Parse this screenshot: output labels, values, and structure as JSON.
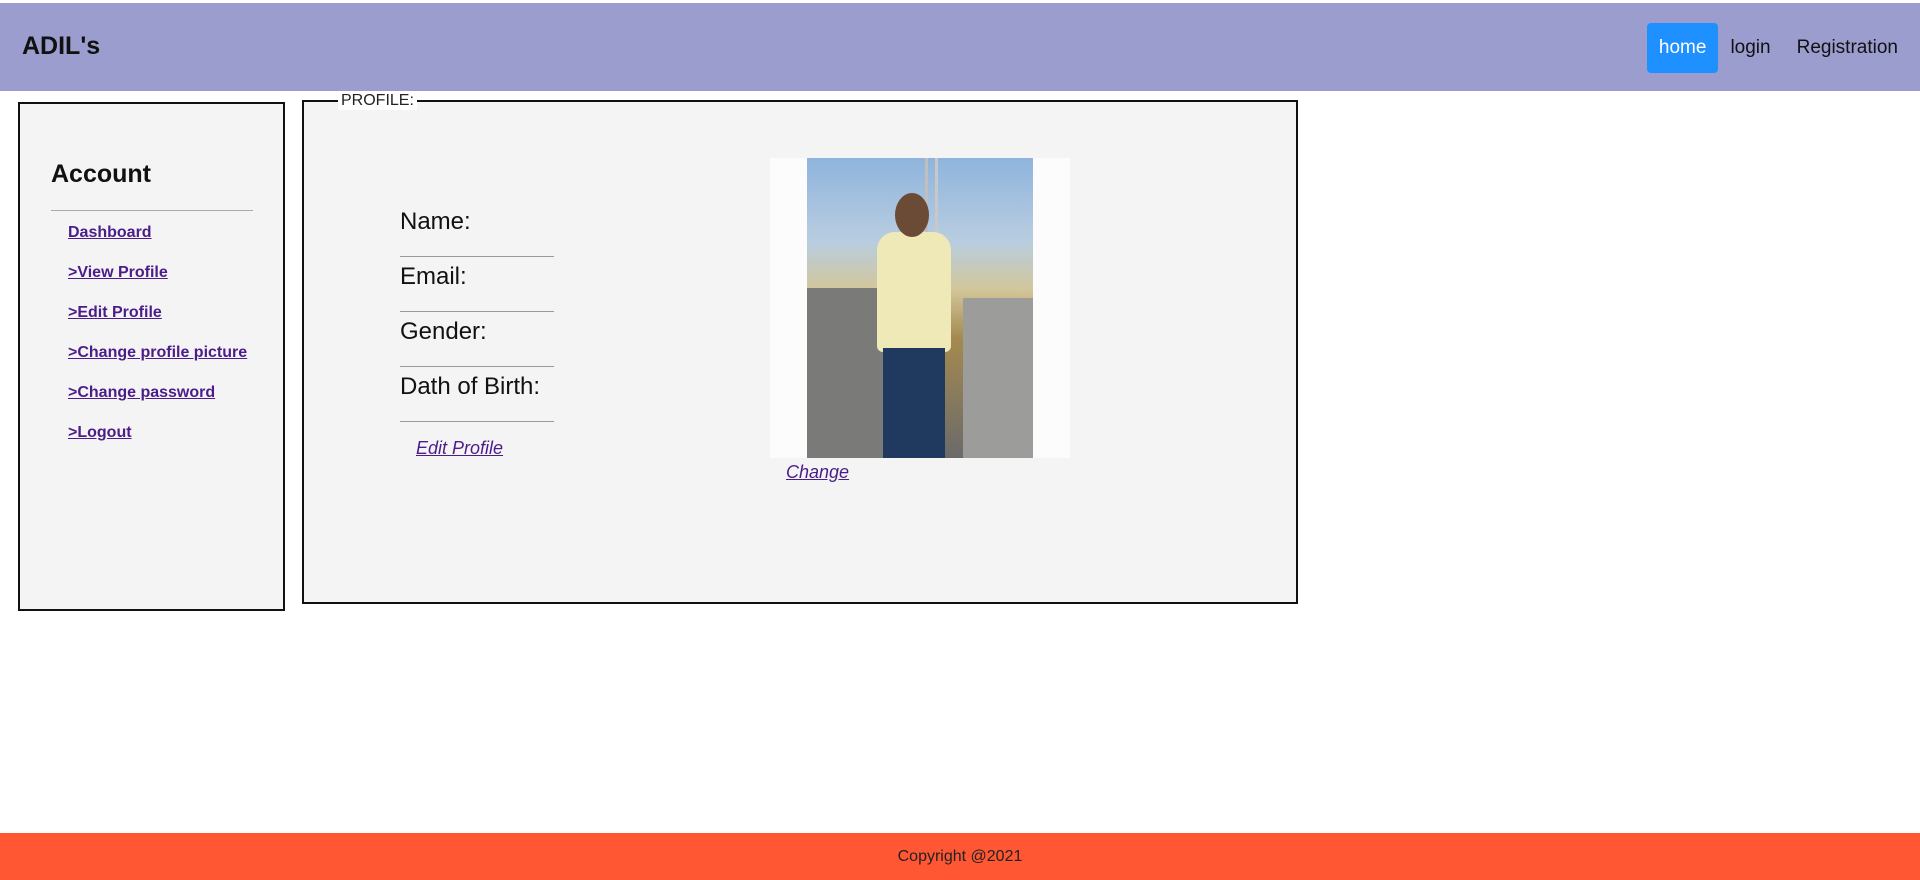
{
  "header": {
    "brand": "ADIL's",
    "nav": [
      "home",
      "login",
      "Registration"
    ]
  },
  "sidebar": {
    "title": "Account",
    "items": [
      "Dashboard",
      ">View Profile",
      ">Edit Profile",
      ">Change profile picture",
      ">Change password",
      ">Logout"
    ]
  },
  "profile": {
    "legend": "PROFILE:",
    "fields": [
      "Name:",
      "Email:",
      "Gender:",
      "Dath of Birth:"
    ],
    "edit_label": "Edit Profile",
    "change_label": "Change"
  },
  "footer": {
    "text": "Copyright @2021"
  },
  "colors": {
    "header_bg": "#9b9dcf",
    "nav_active": "#1e90ff",
    "footer_bg": "#ff5733",
    "link": "#4b1d8a"
  }
}
